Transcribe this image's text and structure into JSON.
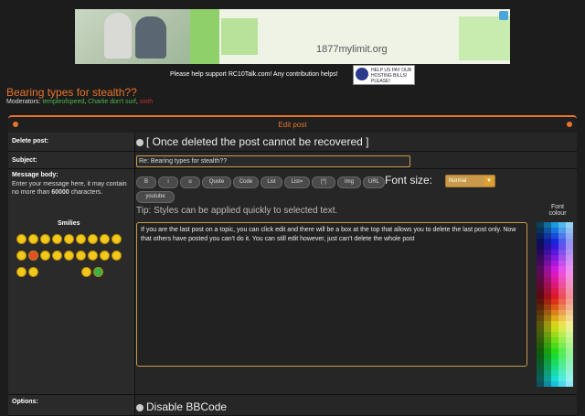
{
  "ad": {
    "url": "1877mylimit.org"
  },
  "support": {
    "text": "Please help support RC10Talk.com! Any contribution helps!",
    "badge_text": "HELP US PAY OUR HOSTING BILLS! PLEASE!"
  },
  "page_title": "Bearing types for stealth??",
  "moderators": {
    "label": "Moderators:",
    "list": [
      "templeofspeed",
      "Charlie don't surf",
      "sixth"
    ]
  },
  "panel": {
    "title": "Edit post"
  },
  "delete": {
    "label": "Delete post:",
    "text": "[ Once deleted the post cannot be recovered ]"
  },
  "subject": {
    "label": "Subject:",
    "value": "Re: Bearing types for stealth??"
  },
  "message": {
    "label": "Message body:",
    "desc_pre": "Enter your message here, it may contain no more than ",
    "limit": "60000",
    "desc_post": " characters.",
    "body": "If you are the last post on a topic, you can click edit and there will be a box at the top that allows you to delete the last post only. Now that others have posted you can't do it. You can still edit however, just can't delete the whole post"
  },
  "smilies": {
    "title": "Smilies"
  },
  "toolbar": {
    "buttons": [
      "B",
      "i",
      "u",
      "Quote",
      "Code",
      "List",
      "List=",
      "[*]",
      "Img",
      "URL",
      "youtube"
    ],
    "font_size_label": "Font size:",
    "font_size_value": "Normal"
  },
  "tip": "Tip: Styles can be applied quickly to selected text.",
  "font_colour": {
    "label": "Font colour"
  },
  "options": {
    "label": "Options:",
    "disable_bbcode": "Disable BBCode"
  },
  "colors": {
    "accent": "#e8742a",
    "moderator": "#4bb64b",
    "admin": "#c03030"
  }
}
